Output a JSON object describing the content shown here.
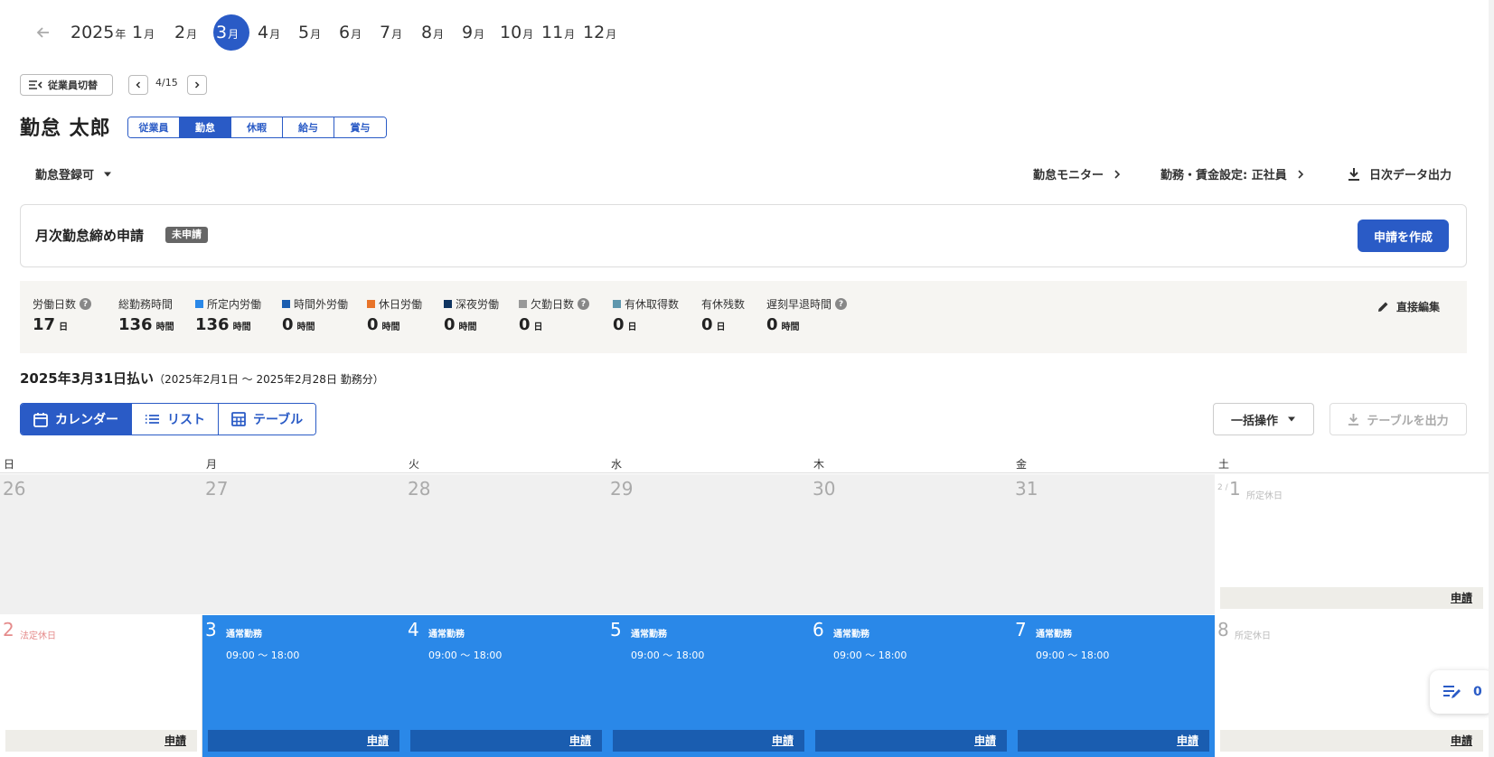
{
  "month_nav": {
    "year": "2025",
    "year_suffix": "年",
    "month_suffix": "月",
    "months": [
      "1",
      "2",
      "3",
      "4",
      "5",
      "6",
      "7",
      "8",
      "9",
      "10",
      "11",
      "12"
    ],
    "selected_month": "3"
  },
  "employee_nav": {
    "switch_label": "従業員切替",
    "counter": "4/15"
  },
  "employee": {
    "name": "勤怠 太郎",
    "tabs": [
      "従業員",
      "勤怠",
      "休暇",
      "給与",
      "賞与"
    ],
    "active_tab": "勤怠"
  },
  "status_row": {
    "status_label": "勤怠登録可",
    "monitor_link": "勤怠モニター",
    "settings_link": "勤務・賃金設定: 正社員",
    "export_daily": "日次データ出力"
  },
  "closing": {
    "title": "月次勤怠締め申請",
    "badge": "未申請",
    "create_button": "申請を作成"
  },
  "summary": {
    "items": [
      {
        "label": "労働日数",
        "value": "17",
        "unit": "日",
        "help": "?"
      },
      {
        "label": "総勤務時間",
        "value": "136",
        "unit": "時間"
      },
      {
        "label": "所定内労働",
        "value": "136",
        "unit": "時間",
        "color": "#2a88e8"
      },
      {
        "label": "時間外労働",
        "value": "0",
        "unit": "時間",
        "color": "#1a5db0"
      },
      {
        "label": "休日労働",
        "value": "0",
        "unit": "時間",
        "color": "#e8742a"
      },
      {
        "label": "深夜労働",
        "value": "0",
        "unit": "時間",
        "color": "#0f3460"
      },
      {
        "label": "欠勤日数",
        "value": "0",
        "unit": "日",
        "color": "#999999",
        "help": "?"
      },
      {
        "label": "有休取得数",
        "value": "0",
        "unit": "日",
        "color": "#5f97ad"
      },
      {
        "label": "有休残数",
        "value": "0",
        "unit": "日"
      },
      {
        "label": "遅刻早退時間",
        "value": "0",
        "unit": "時間",
        "help": "?"
      }
    ],
    "direct_edit": "直接編集"
  },
  "pay_period": {
    "pay_date": "2025年3月31日払い",
    "range": "（2025年2月1日 〜 2025年2月28日 勤務分）"
  },
  "view": {
    "calendar": "カレンダー",
    "list": "リスト",
    "table": "テーブル",
    "bulk": "一括操作",
    "export_table": "テーブルを出力"
  },
  "calendar": {
    "weekdays": [
      "日",
      "月",
      "火",
      "水",
      "木",
      "金",
      "土"
    ],
    "week1": {
      "days": [
        "26",
        "27",
        "28",
        "29",
        "30",
        "31",
        "1"
      ],
      "sat_prefix": "2 /",
      "sat_note": "所定休日",
      "apply": "申請"
    },
    "week2": {
      "sun_day": "2",
      "sun_note": "法定休日",
      "weekdays": [
        {
          "day": "3",
          "type": "通常勤務",
          "time": "09:00 〜 18:00"
        },
        {
          "day": "4",
          "type": "通常勤務",
          "time": "09:00 〜 18:00"
        },
        {
          "day": "5",
          "type": "通常勤務",
          "time": "09:00 〜 18:00"
        },
        {
          "day": "6",
          "type": "通常勤務",
          "time": "09:00 〜 18:00"
        },
        {
          "day": "7",
          "type": "通常勤務",
          "time": "09:00 〜 18:00"
        }
      ],
      "sat_day": "8",
      "sat_note": "所定休日",
      "apply": "申請"
    }
  },
  "memo": {
    "count": "0"
  }
}
